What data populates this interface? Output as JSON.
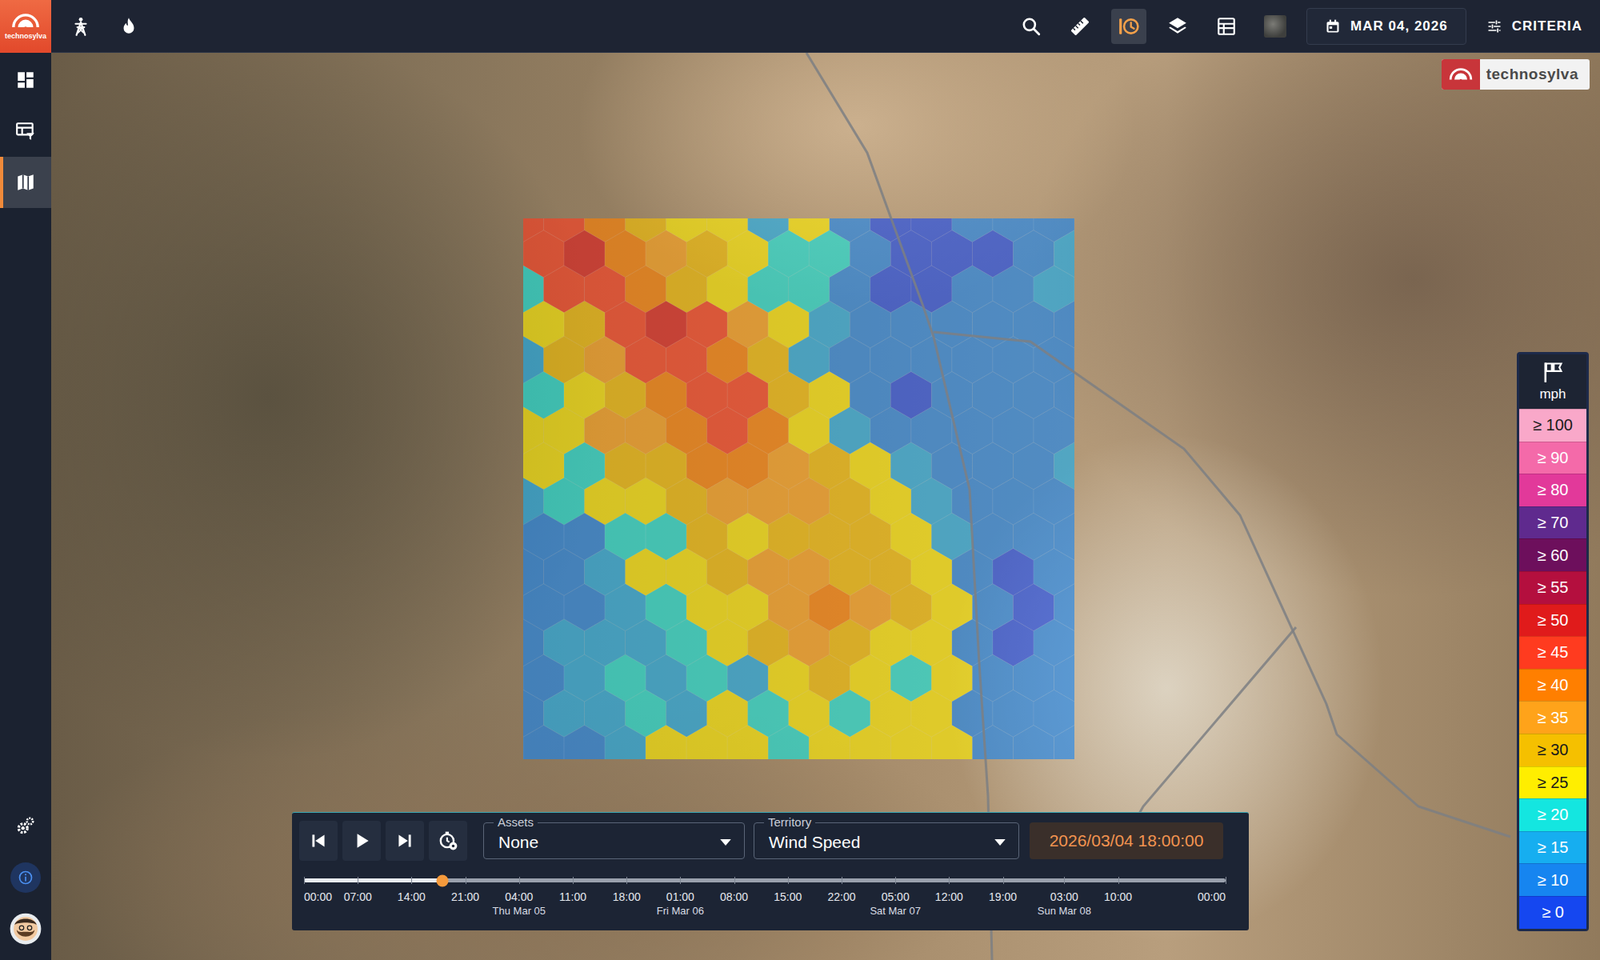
{
  "app": {
    "logo_text": "technosylva"
  },
  "top_bar": {
    "left_tools": [
      {
        "kind": "assets",
        "selected": false
      },
      {
        "kind": "fire",
        "selected": false
      }
    ],
    "right_tools": [
      {
        "kind": "search",
        "selected": false
      },
      {
        "kind": "measure",
        "selected": false
      },
      {
        "kind": "history",
        "selected": true
      },
      {
        "kind": "layers",
        "selected": false
      },
      {
        "kind": "table",
        "selected": false
      },
      {
        "kind": "imagery",
        "selected": false
      }
    ],
    "date_button": {
      "label": "MAR 04, 2026"
    },
    "criteria_button": {
      "label": "CRITERIA"
    }
  },
  "sidebar": {
    "items": [
      {
        "kind": "dashboard",
        "selected": false
      },
      {
        "kind": "table-filter",
        "selected": false
      },
      {
        "kind": "map",
        "selected": true
      }
    ],
    "bottom_items": [
      {
        "kind": "settings"
      },
      {
        "kind": "info"
      },
      {
        "kind": "avatar"
      }
    ]
  },
  "map": {
    "watermark": "technosylva",
    "overlay": {
      "layer": "Wind Speed",
      "values": [
        [
          48,
          46,
          42,
          32,
          28,
          27,
          15,
          26,
          12,
          8,
          5,
          10,
          12,
          14
        ],
        [
          47,
          50,
          44,
          36,
          30,
          27,
          20,
          22,
          12,
          6,
          4,
          8,
          14,
          18
        ],
        [
          22,
          47,
          48,
          40,
          32,
          28,
          20,
          20,
          14,
          8,
          6,
          10,
          12,
          16
        ],
        [
          28,
          34,
          46,
          50,
          47,
          35,
          28,
          18,
          14,
          12,
          10,
          12,
          14,
          14
        ],
        [
          18,
          30,
          38,
          48,
          49,
          40,
          30,
          18,
          14,
          10,
          12,
          14,
          14,
          14
        ],
        [
          20,
          26,
          34,
          42,
          48,
          46,
          32,
          26,
          12,
          8,
          14,
          14,
          14,
          14
        ],
        [
          27,
          28,
          36,
          38,
          44,
          48,
          40,
          28,
          18,
          12,
          14,
          14,
          14,
          14
        ],
        [
          26,
          20,
          30,
          34,
          40,
          42,
          38,
          34,
          28,
          16,
          14,
          14,
          14,
          16
        ],
        [
          16,
          22,
          26,
          28,
          34,
          38,
          36,
          36,
          30,
          26,
          18,
          14,
          14,
          14
        ],
        [
          14,
          14,
          20,
          22,
          30,
          28,
          34,
          32,
          30,
          26,
          18,
          14,
          14,
          14
        ],
        [
          14,
          14,
          16,
          28,
          26,
          30,
          36,
          38,
          32,
          30,
          26,
          12,
          6,
          12
        ],
        [
          14,
          14,
          16,
          20,
          28,
          26,
          38,
          40,
          36,
          30,
          28,
          10,
          4,
          10
        ],
        [
          14,
          16,
          16,
          18,
          22,
          26,
          30,
          36,
          30,
          28,
          26,
          10,
          6,
          12
        ],
        [
          14,
          16,
          20,
          18,
          20,
          18,
          28,
          30,
          26,
          20,
          28,
          12,
          10,
          12
        ],
        [
          14,
          16,
          16,
          20,
          18,
          28,
          20,
          26,
          20,
          26,
          28,
          12,
          10,
          12
        ],
        [
          14,
          14,
          16,
          28,
          28,
          28,
          20,
          28,
          28,
          28,
          26,
          12,
          12,
          12
        ]
      ]
    }
  },
  "legend": {
    "unit": "mph",
    "bins": [
      {
        "label": "≥ 100",
        "color": "#f9a8c9"
      },
      {
        "label": "≥ 90",
        "color": "#f46aa9"
      },
      {
        "label": "≥ 80",
        "color": "#e2399a"
      },
      {
        "label": "≥ 70",
        "color": "#5f2a8e"
      },
      {
        "label": "≥ 60",
        "color": "#6d0f5c"
      },
      {
        "label": "≥ 55",
        "color": "#b40f3e"
      },
      {
        "label": "≥ 50",
        "color": "#e01b1b"
      },
      {
        "label": "≥ 45",
        "color": "#ff3b1f"
      },
      {
        "label": "≥ 40",
        "color": "#ff7f00"
      },
      {
        "label": "≥ 35",
        "color": "#ffa31a"
      },
      {
        "label": "≥ 30",
        "color": "#f5c000"
      },
      {
        "label": "≥ 25",
        "color": "#ffee00"
      },
      {
        "label": "≥ 20",
        "color": "#14e6e0"
      },
      {
        "label": "≥ 15",
        "color": "#16aef0"
      },
      {
        "label": "≥ 10",
        "color": "#1685f0"
      },
      {
        "label": "≥ 0",
        "color": "#1547f0"
      }
    ]
  },
  "timeline": {
    "controls": [
      {
        "kind": "first"
      },
      {
        "kind": "play"
      },
      {
        "kind": "last"
      },
      {
        "kind": "speed"
      }
    ],
    "assets": {
      "label": "Assets",
      "value": "None"
    },
    "territory": {
      "label": "Territory",
      "value": "Wind Speed"
    },
    "current_time": "2026/03/04 18:00:00",
    "level": 0.15,
    "ticks": [
      {
        "time": "00:00",
        "day": ""
      },
      {
        "time": "07:00",
        "day": ""
      },
      {
        "time": "14:00",
        "day": ""
      },
      {
        "time": "21:00",
        "day": ""
      },
      {
        "time": "04:00",
        "day": "Thu Mar 05"
      },
      {
        "time": "11:00",
        "day": ""
      },
      {
        "time": "18:00",
        "day": ""
      },
      {
        "time": "01:00",
        "day": "Fri Mar 06"
      },
      {
        "time": "08:00",
        "day": ""
      },
      {
        "time": "15:00",
        "day": ""
      },
      {
        "time": "22:00",
        "day": ""
      },
      {
        "time": "05:00",
        "day": "Sat Mar 07"
      },
      {
        "time": "12:00",
        "day": ""
      },
      {
        "time": "19:00",
        "day": ""
      },
      {
        "time": "03:00",
        "day": "Sun Mar 08"
      },
      {
        "time": "10:00",
        "day": ""
      },
      {
        "time": "00:00",
        "day": ""
      }
    ]
  }
}
